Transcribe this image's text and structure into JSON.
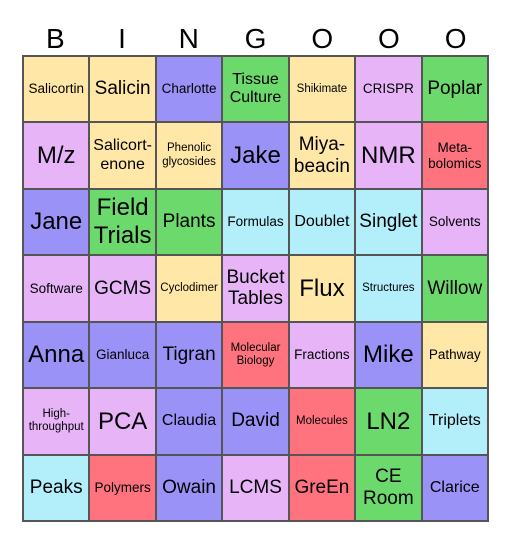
{
  "header": [
    "B",
    "I",
    "N",
    "G",
    "O",
    "O",
    "O"
  ],
  "colors": {
    "yellow": "#ffe7a8",
    "blue": "#9b92f7",
    "green": "#6bd96b",
    "purple": "#e7b4f8",
    "red": "#ff737f",
    "cyan": "#b3eefb"
  },
  "cells": [
    {
      "text": "Salicortin",
      "color": "yellow",
      "size": "s"
    },
    {
      "text": "Salicin",
      "color": "yellow",
      "size": "l"
    },
    {
      "text": "Charlotte",
      "color": "blue",
      "size": "s"
    },
    {
      "text": "Tissue Culture",
      "color": "green",
      "size": "m"
    },
    {
      "text": "Shikimate",
      "color": "yellow",
      "size": "xs"
    },
    {
      "text": "CRISPR",
      "color": "purple",
      "size": "s"
    },
    {
      "text": "Poplar",
      "color": "green",
      "size": "l"
    },
    {
      "text": "M/z",
      "color": "purple",
      "size": "xl"
    },
    {
      "text": "Salicort-enone",
      "color": "yellow",
      "size": "m"
    },
    {
      "text": "Phenolic glycosides",
      "color": "yellow",
      "size": "xs"
    },
    {
      "text": "Jake",
      "color": "blue",
      "size": "xl"
    },
    {
      "text": "Miya-beacin",
      "color": "yellow",
      "size": "l"
    },
    {
      "text": "NMR",
      "color": "purple",
      "size": "xl"
    },
    {
      "text": "Meta-bolomics",
      "color": "red",
      "size": "s"
    },
    {
      "text": "Jane",
      "color": "blue",
      "size": "xl"
    },
    {
      "text": "Field Trials",
      "color": "green",
      "size": "xl"
    },
    {
      "text": "Plants",
      "color": "green",
      "size": "l"
    },
    {
      "text": "Formulas",
      "color": "cyan",
      "size": "s"
    },
    {
      "text": "Doublet",
      "color": "cyan",
      "size": "m"
    },
    {
      "text": "Singlet",
      "color": "cyan",
      "size": "l"
    },
    {
      "text": "Solvents",
      "color": "purple",
      "size": "s"
    },
    {
      "text": "Software",
      "color": "purple",
      "size": "s"
    },
    {
      "text": "GCMS",
      "color": "purple",
      "size": "l"
    },
    {
      "text": "Cyclodimer",
      "color": "yellow",
      "size": "xs"
    },
    {
      "text": "Bucket Tables",
      "color": "purple",
      "size": "l"
    },
    {
      "text": "Flux",
      "color": "yellow",
      "size": "xl"
    },
    {
      "text": "Structures",
      "color": "cyan",
      "size": "xs"
    },
    {
      "text": "Willow",
      "color": "green",
      "size": "l"
    },
    {
      "text": "Anna",
      "color": "blue",
      "size": "xl"
    },
    {
      "text": "Gianluca",
      "color": "blue",
      "size": "s"
    },
    {
      "text": "Tigran",
      "color": "blue",
      "size": "l"
    },
    {
      "text": "Molecular Biology",
      "color": "red",
      "size": "xs"
    },
    {
      "text": "Fractions",
      "color": "purple",
      "size": "s"
    },
    {
      "text": "Mike",
      "color": "blue",
      "size": "xl"
    },
    {
      "text": "Pathway",
      "color": "yellow",
      "size": "s"
    },
    {
      "text": "High-throughput",
      "color": "purple",
      "size": "xs"
    },
    {
      "text": "PCA",
      "color": "purple",
      "size": "xl"
    },
    {
      "text": "Claudia",
      "color": "blue",
      "size": "m"
    },
    {
      "text": "David",
      "color": "blue",
      "size": "l"
    },
    {
      "text": "Molecules",
      "color": "red",
      "size": "xs"
    },
    {
      "text": "LN2",
      "color": "green",
      "size": "xl"
    },
    {
      "text": "Triplets",
      "color": "cyan",
      "size": "m"
    },
    {
      "text": "Peaks",
      "color": "cyan",
      "size": "l"
    },
    {
      "text": "Polymers",
      "color": "red",
      "size": "s"
    },
    {
      "text": "Owain",
      "color": "blue",
      "size": "l"
    },
    {
      "text": "LCMS",
      "color": "purple",
      "size": "l"
    },
    {
      "text": "GreEn",
      "color": "red",
      "size": "l"
    },
    {
      "text": "CE Room",
      "color": "green",
      "size": "l"
    },
    {
      "text": "Clarice",
      "color": "blue",
      "size": "m"
    }
  ]
}
